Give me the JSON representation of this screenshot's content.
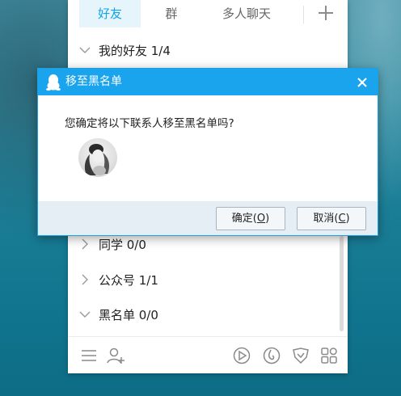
{
  "tabs": [
    {
      "label": "好友",
      "active": true
    },
    {
      "label": "群",
      "active": false
    },
    {
      "label": "多人聊天",
      "active": false
    }
  ],
  "groups": [
    {
      "label": "我的好友 1/4",
      "expanded": true
    },
    {
      "label": "同学 0/0",
      "expanded": false
    },
    {
      "label": "公众号 1/1",
      "expanded": false
    },
    {
      "label": "黑名单 0/0",
      "expanded": true
    }
  ],
  "dialog": {
    "title": "移至黑名单",
    "question": "您确定将以下联系人移至黑名单吗?",
    "confirm_label": "确定(",
    "confirm_key": "O",
    "cancel_label": "取消(",
    "cancel_key": "C",
    "close_text": "×"
  },
  "footer_icons": [
    "menu-icon",
    "add-friend-icon",
    "video-play-icon",
    "music-icon",
    "shield-check-icon",
    "apps-grid-icon"
  ],
  "colors": {
    "accent": "#1ba4ee",
    "tab_active_text": "#12a4e8",
    "tab_active_bg": "#e6f4fb",
    "dialog_footer_bg": "#e5eef5"
  }
}
